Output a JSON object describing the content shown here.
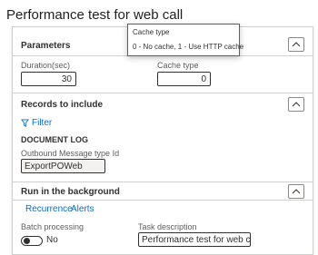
{
  "dialog": {
    "title": "Performance test for web call"
  },
  "parameters": {
    "header": "Parameters",
    "duration_label": "Duration(sec)",
    "duration_value": "30",
    "cache_type_label": "Cache type",
    "cache_type_value": "0"
  },
  "tooltip": {
    "title": "Cache type",
    "text": "0 - No cache, 1 - Use HTTP cache"
  },
  "records": {
    "header": "Records to include",
    "filter_label": "Filter",
    "document_log_label": "DOCUMENT LOG",
    "outbound_label": "Outbound Message type Id",
    "outbound_value": "ExportPOWeb"
  },
  "background": {
    "header": "Run in the background",
    "links": [
      "Recurrence",
      "Alerts"
    ],
    "batch_label": "Batch processing",
    "batch_value": "No",
    "task_label": "Task description",
    "task_value": "Performance test for web call"
  },
  "icons": {
    "collapse": "chevron-up-icon",
    "filter": "funnel-icon"
  },
  "colors": {
    "accent": "#0f6cbd",
    "border": "#d2d0ce"
  }
}
